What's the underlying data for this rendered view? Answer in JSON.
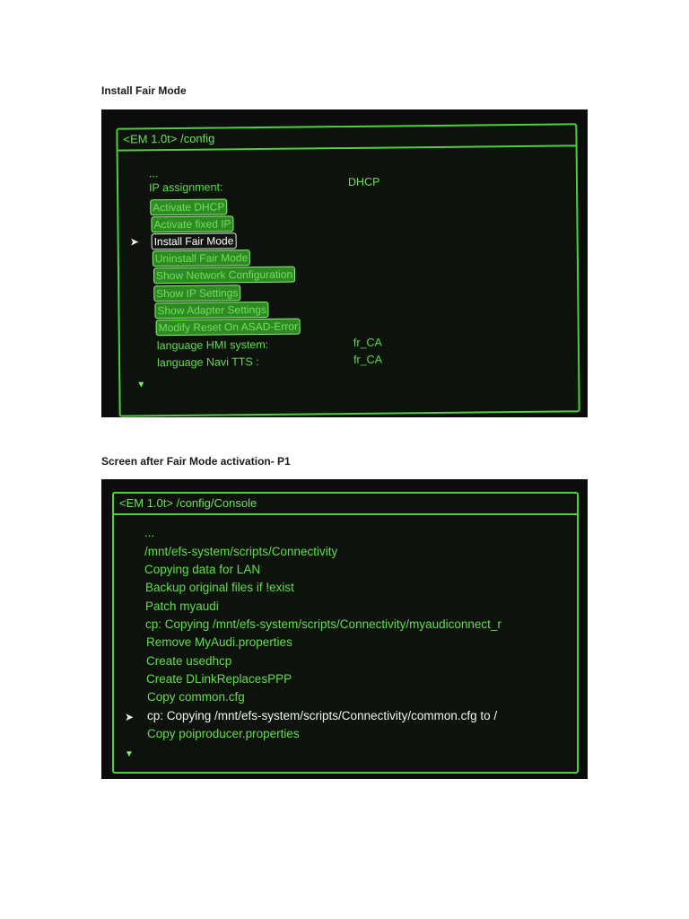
{
  "figure1": {
    "caption": "Install Fair Mode",
    "title": "<EM 1.0t>  /config",
    "ellipsis": "...",
    "ip_label": "IP assignment:",
    "ip_value": "DHCP",
    "menu": [
      "Activate DHCP",
      "Activate fixed IP",
      "Install Fair Mode",
      "Uninstall Fair Mode",
      "Show Network Configuration",
      "Show IP Settings",
      "Show Adapter Settings",
      "Modify Reset On ASAD-Error"
    ],
    "selected_index": 2,
    "lang_hmi_label": "language HMI system:",
    "lang_hmi_value": "fr_CA",
    "lang_tts_label": "language Navi TTS :",
    "lang_tts_value": "fr_CA",
    "selector_icon": "arrow-right-icon",
    "scroll_icon": "triangle-down-icon"
  },
  "figure2": {
    "caption": "Screen after Fair Mode activation- P1",
    "title": "<EM 1.0t>  /config/Console",
    "lines": [
      "...",
      "/mnt/efs-system/scripts/Connectivity",
      "Copying data for LAN",
      "Backup original files if !exist",
      "Patch myaudi",
      "cp: Copying /mnt/efs-system/scripts/Connectivity/myaudiconnect_r",
      "Remove MyAudi.properties",
      "Create usedhcp",
      "Create DLinkReplacesPPP",
      "Copy common.cfg",
      "cp: Copying /mnt/efs-system/scripts/Connectivity/common.cfg to /",
      "Copy poiproducer.properties"
    ],
    "selected_index": 10,
    "selector_icon": "arrow-right-icon",
    "scroll_icon": "triangle-down-icon"
  },
  "colors": {
    "screen_green": "#5fdc4b",
    "button_fill": "#2f8a24",
    "selected_text": "#ffffff",
    "background": "#0b0d0b"
  }
}
